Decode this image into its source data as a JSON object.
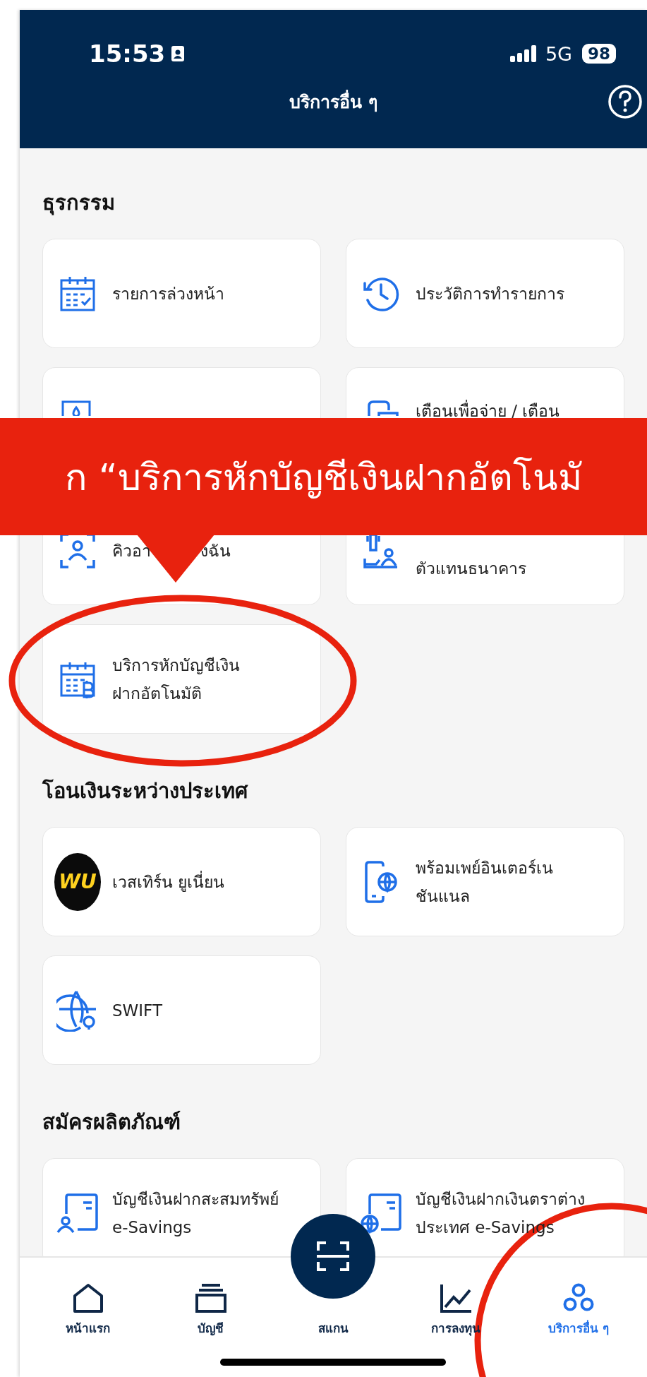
{
  "status_bar": {
    "time": "15:53",
    "network": "5G",
    "battery": "98"
  },
  "header": {
    "title": "บริการอื่น ๆ"
  },
  "sections": [
    {
      "title": "ธุรกรรม",
      "items": [
        {
          "kind": "calendar",
          "lines": [
            "รายการล่วงหน้า"
          ]
        },
        {
          "kind": "history",
          "lines": [
            "ประวัติการทำรายการ"
          ]
        },
        {
          "kind": "drop"
        },
        {
          "kind": "bill",
          "lines": [
            "เตือนเพื่อจ่าย / เตือน"
          ]
        },
        {
          "kind": "qr-person",
          "label_parts": [
            "คิวอา",
            "งฉัน"
          ]
        },
        {
          "kind": "agent",
          "lines": [
            "ตัวแทนธนาคาร"
          ]
        },
        {
          "kind": "autodebit",
          "lines": [
            "บริการหักบัญชีเงิน",
            "ฝากอัตโนมัติ"
          ]
        }
      ]
    },
    {
      "title": "โอนเงินระหว่างประเทศ",
      "items": [
        {
          "kind": "wu",
          "logo_text": "WU",
          "lines": [
            "เวสเทิร์น ยูเนี่ยน"
          ]
        },
        {
          "kind": "phone-globe",
          "lines": [
            "พร้อมเพย์อินเตอร์เน",
            "ชันแนล"
          ]
        },
        {
          "kind": "globe-pin",
          "lines": [
            "SWIFT"
          ]
        }
      ]
    },
    {
      "title": "สมัครผลิตภัณฑ์",
      "items": [
        {
          "kind": "account-person",
          "lines": [
            "บัญชีเงินฝากสะสมทรัพย์",
            "e-Savings"
          ]
        },
        {
          "kind": "account-globe",
          "lines": [
            "บัญชีเงินฝากเงินตราต่าง",
            "ประเทศ e-Savings"
          ]
        }
      ]
    }
  ],
  "nav": [
    {
      "kind": "home",
      "label": "หน้าแรก",
      "selected": false
    },
    {
      "kind": "accounts",
      "label": "บัญชี",
      "selected": false
    },
    {
      "kind": "scan",
      "label": "สแกน",
      "selected": false
    },
    {
      "kind": "invest",
      "label": "การลงทุน",
      "selected": false
    },
    {
      "kind": "more",
      "label": "บริการอื่น ๆ",
      "selected": true
    }
  ],
  "annotation": {
    "text": "ก “บริการหักบัญชีเงินฝากอัตโนมั"
  }
}
